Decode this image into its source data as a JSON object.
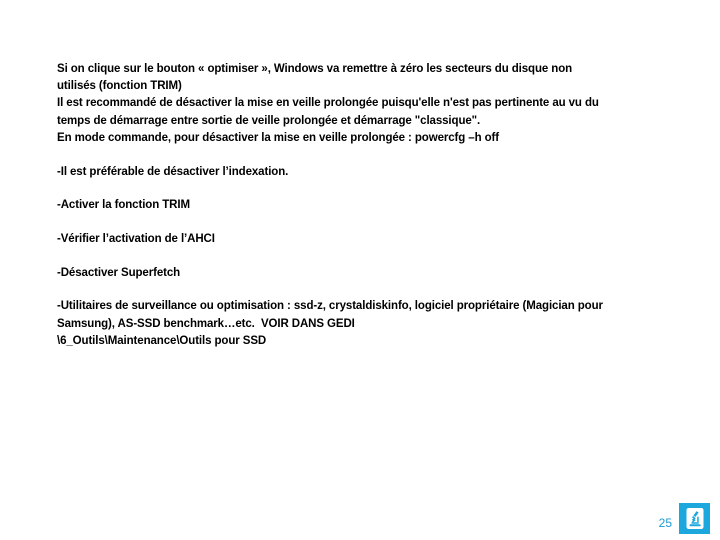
{
  "slide": {
    "paragraphs": [
      {
        "id": "intro-optimiser",
        "text": "Si on clique sur le bouton « optimiser », Windows va remettre à zéro les secteurs du disque non utilisés (fonction TRIM)\nIl est recommandé de désactiver la mise en veille prolongée puisqu'elle n'est pas pertinente au vu du temps de démarrage entre sortie de veille prolongée et démarrage \"classique\".\nEn mode commande, pour désactiver la mise en veille prolongée : powercfg –h off"
      }
    ],
    "bullets": [
      {
        "id": "indexation",
        "text": "-Il est préférable de désactiver l’indexation."
      },
      {
        "id": "trim",
        "text": "-Activer la fonction TRIM"
      },
      {
        "id": "ahci",
        "text": "-Vérifier l’activation de l’AHCI"
      },
      {
        "id": "superfetch",
        "text": "-Désactiver Superfetch"
      }
    ],
    "closing": {
      "id": "utilitaires",
      "text": "-Utilitaires de surveillance ou optimisation : ssd-z, crystaldiskinfo, logiciel propriétaire (Magician pour Samsung), AS-SSD benchmark…etc.  VOIR DANS GEDI\n\\6_Outils\\Maintenance\\Outils pour SSD"
    },
    "footer": {
      "page_number": "25",
      "logo_icon": "microscope-document-icon",
      "logo_color": "#1CA7DD",
      "page_number_color": "#1C9AD6"
    }
  }
}
